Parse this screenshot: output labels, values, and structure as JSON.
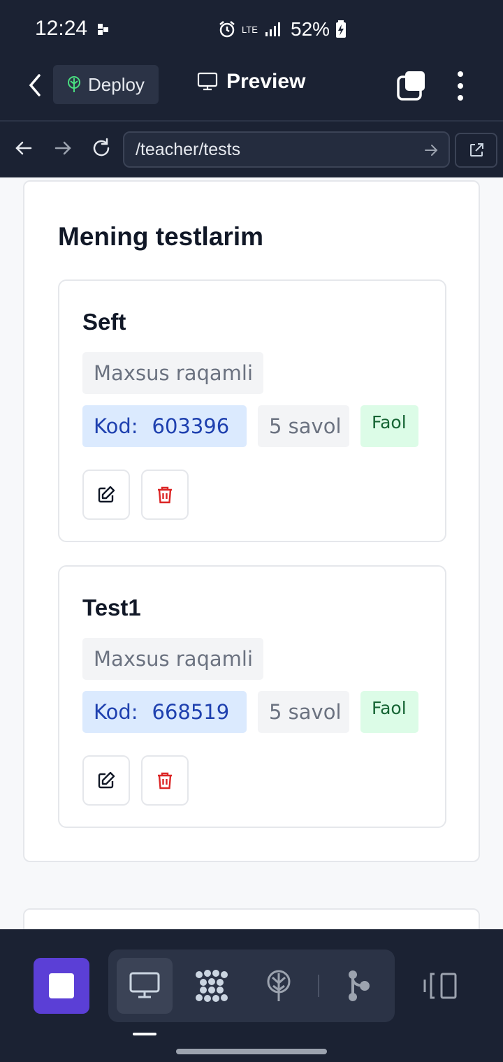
{
  "status_bar": {
    "time": "12:24",
    "network": "LTE",
    "battery": "52%"
  },
  "app_bar": {
    "deploy_label": "Deploy",
    "preview_label": "Preview"
  },
  "browser": {
    "url": "/teacher/tests"
  },
  "main": {
    "title": "Mening testlarim",
    "tests": [
      {
        "name": "Seft",
        "type": "Maxsus raqamli",
        "code_label": "Kod:",
        "code": "603396",
        "questions": "5 savol",
        "status": "Faol"
      },
      {
        "name": "Test1",
        "type": "Maxsus raqamli",
        "code_label": "Kod:",
        "code": "668519",
        "questions": "5 savol",
        "status": "Faol"
      }
    ]
  },
  "dock": {
    "tools": [
      "monitor-icon",
      "dots-grid-icon",
      "deploy-tree-icon",
      "branch-icon"
    ]
  },
  "colors": {
    "header_bg": "#1b2233",
    "accent": "#5b3fd6",
    "code_bg": "#dbeafe",
    "status_bg": "#dcfce7",
    "delete": "#dc2626"
  }
}
